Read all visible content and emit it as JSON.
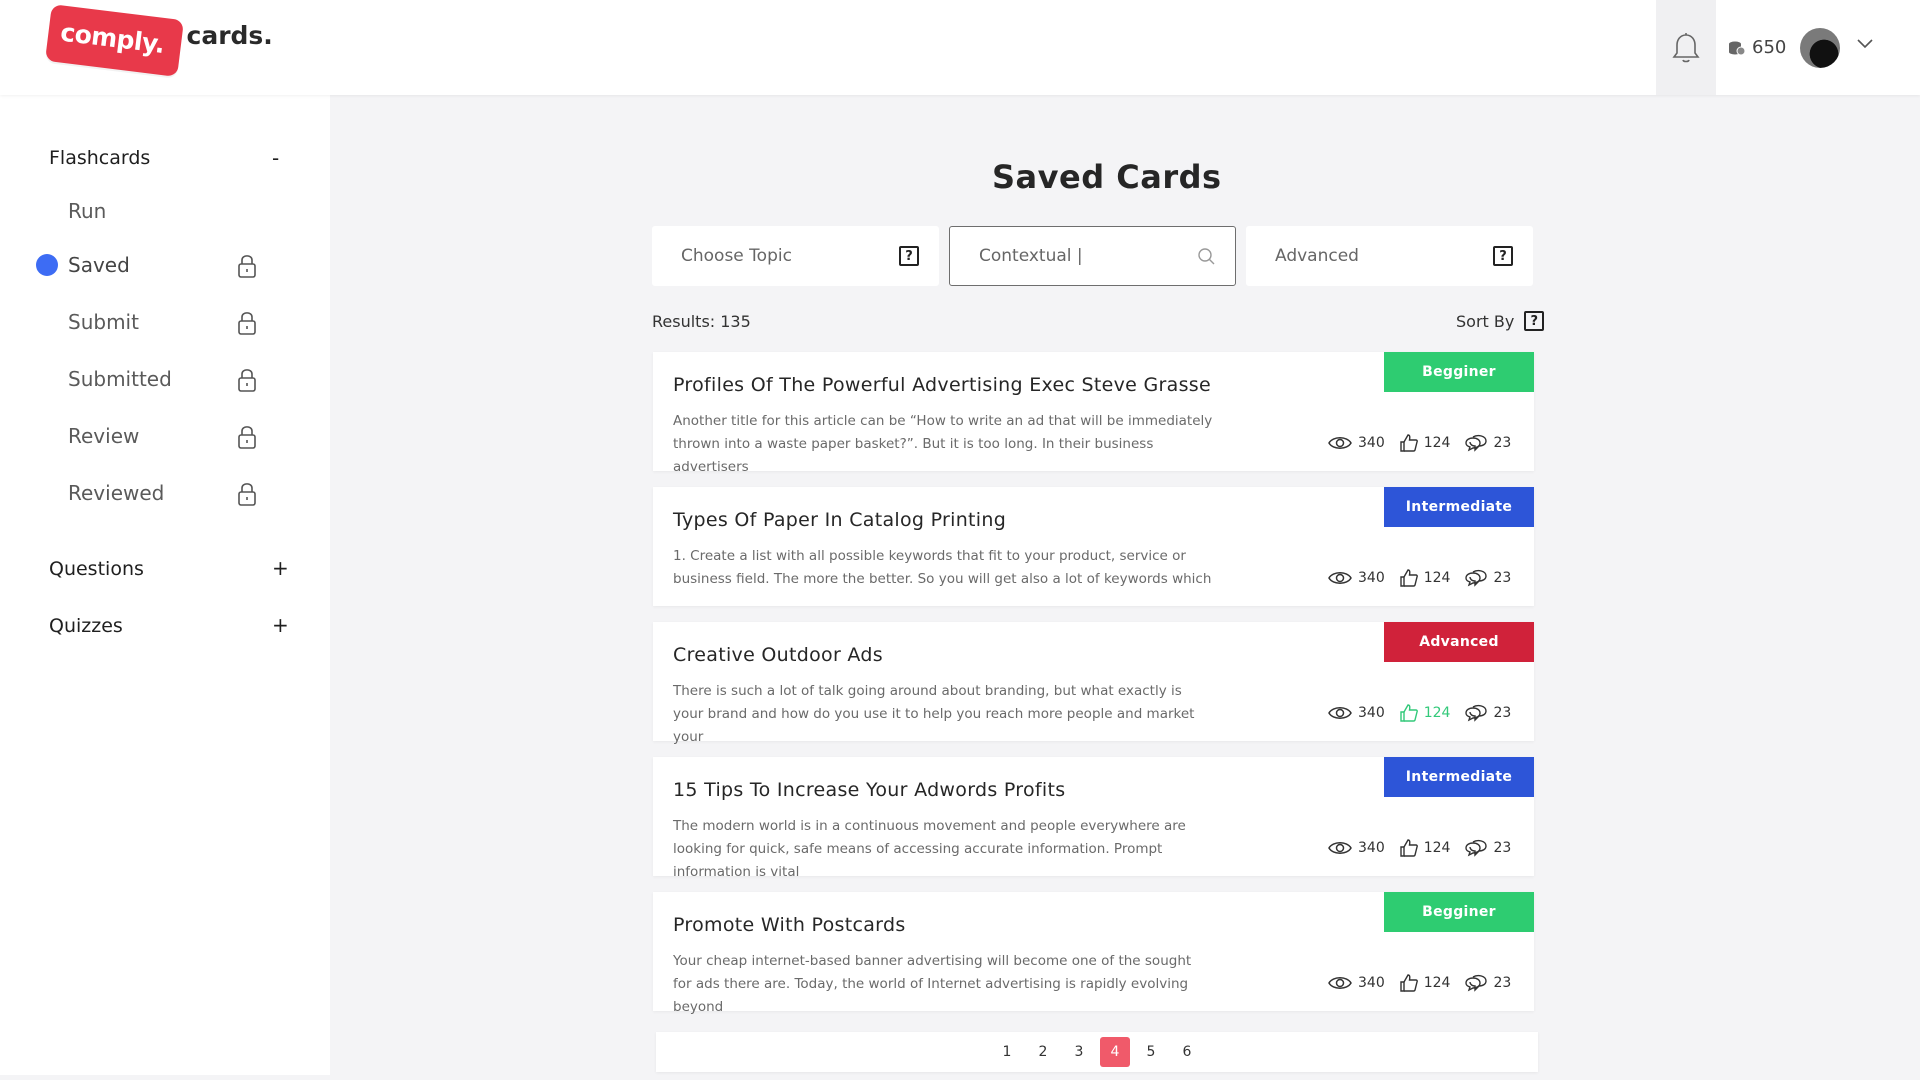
{
  "header": {
    "logo_badge": "comply.",
    "logo_text": "cards.",
    "coins": "650"
  },
  "sidebar": {
    "sections": [
      {
        "label": "Flashcards",
        "toggle": "-"
      },
      {
        "label": "Questions",
        "toggle": "+"
      },
      {
        "label": "Quizzes",
        "toggle": "+"
      }
    ],
    "items": [
      {
        "label": "Run"
      },
      {
        "label": "Saved"
      },
      {
        "label": "Submit"
      },
      {
        "label": "Submitted"
      },
      {
        "label": "Review"
      },
      {
        "label": "Reviewed"
      }
    ]
  },
  "main": {
    "title": "Saved Cards",
    "filters": {
      "topic": "Choose Topic",
      "search_value": "Contextual |",
      "advanced": "Advanced"
    },
    "results": "Results: 135",
    "sort_by": "Sort By",
    "qmark": "?"
  },
  "cards": [
    {
      "title": "Profiles Of The Powerful Advertising Exec Steve Grasse",
      "desc": "Another title for this article can be “How to write an ad that will be immediately thrown into a waste paper basket?”. But it is too long. In their business advertisers",
      "level": "Begginer",
      "views": "340",
      "likes": "124",
      "comments": "23"
    },
    {
      "title": "Types Of Paper In Catalog Printing",
      "desc": "1. Create a list with all possible keywords that fit to your product, service or business field. The more the better. So you will get also a lot of keywords which",
      "level": "Intermediate",
      "views": "340",
      "likes": "124",
      "comments": "23"
    },
    {
      "title": "Creative Outdoor Ads",
      "desc": "There is such a lot of talk going around about branding, but what exactly is your brand and how do you use it to help you reach more people and market your",
      "level": "Advanced",
      "views": "340",
      "likes": "124",
      "comments": "23"
    },
    {
      "title": "15 Tips To Increase Your Adwords Profits",
      "desc": "The modern world is in a continuous movement and people everywhere are looking for quick, safe means of accessing accurate information. Prompt information is vital",
      "level": "Intermediate",
      "views": "340",
      "likes": "124",
      "comments": "23"
    },
    {
      "title": "Promote With Postcards",
      "desc": "Your cheap internet-based banner advertising will become one of the sought for ads there are. Today, the world of Internet advertising is rapidly evolving beyond",
      "level": "Begginer",
      "views": "340",
      "likes": "124",
      "comments": "23"
    }
  ],
  "pagination": {
    "pages": [
      "1",
      "2",
      "3",
      "4",
      "5",
      "6"
    ],
    "current": "4"
  },
  "colors": {
    "begginer": "#2ecc71",
    "intermediate": "#2d55d8",
    "advanced": "#d0223a",
    "liked": "#33c97a",
    "accent_dot": "#3d6cf4",
    "page_current": "#f05a6a"
  }
}
